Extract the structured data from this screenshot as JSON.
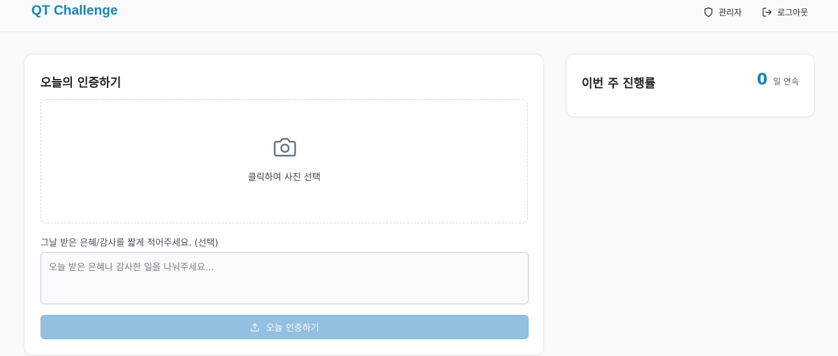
{
  "header": {
    "logo": "QT Challenge",
    "admin_label": "관리자",
    "logout_label": "로그아웃"
  },
  "main_card": {
    "title": "오늘의 인증하기",
    "upload_label": "클릭하여 사진 선택",
    "field_label": "그날 받은 은혜/감사를 짧게 적어주세요. (선택)",
    "textarea_placeholder": "오늘 받은 은혜나 감사한 일을 나눠주세요...",
    "textarea_value": "",
    "submit_label": "오늘 인증하기"
  },
  "side_card": {
    "title": "이번 주 진행률",
    "streak_count": "0",
    "streak_unit": "일 연속"
  },
  "icons": {
    "admin": "shield-icon",
    "logout": "logout-icon",
    "upload_area": "camera-icon",
    "submit": "upload-icon"
  },
  "colors": {
    "brand": "#1a83b3",
    "submit_disabled": "#93c0e0"
  }
}
